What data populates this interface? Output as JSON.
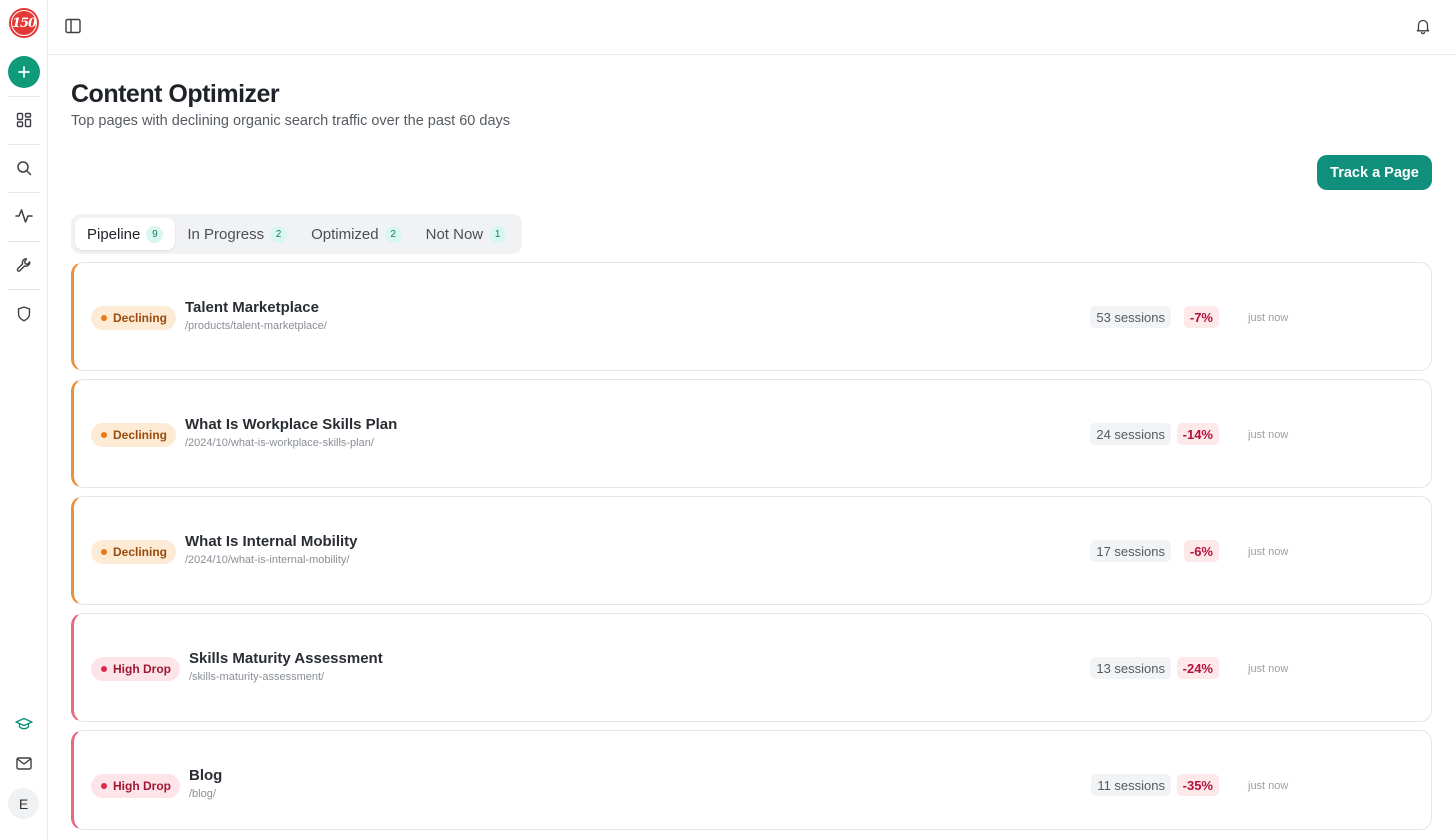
{
  "sidebar": {
    "logo_text": "150",
    "avatar_initial": "E",
    "icons": [
      "plus-icon",
      "dashboard-icon",
      "search-icon",
      "activity-icon",
      "wrench-icon",
      "shield-icon",
      "graduation-cap-icon",
      "mail-icon"
    ]
  },
  "header": {
    "title": "Content Optimizer",
    "subtitle": "Top pages with declining organic search traffic over the past 60 days",
    "track_button": "Track a Page"
  },
  "tabs": [
    {
      "label": "Pipeline",
      "count": "9",
      "active": true
    },
    {
      "label": "In Progress",
      "count": "2",
      "active": false
    },
    {
      "label": "Optimized",
      "count": "2",
      "active": false
    },
    {
      "label": "Not Now",
      "count": "1",
      "active": false
    }
  ],
  "pages": [
    {
      "status": "Declining",
      "title": "Talent Marketplace",
      "path": "/products/talent-marketplace/",
      "sessions": "53 sessions",
      "change": "-7%",
      "updated": "just now"
    },
    {
      "status": "Declining",
      "title": "What Is Workplace Skills Plan",
      "path": "/2024/10/what-is-workplace-skills-plan/",
      "sessions": "24 sessions",
      "change": "-14%",
      "updated": "just now"
    },
    {
      "status": "Declining",
      "title": "What Is Internal Mobility",
      "path": "/2024/10/what-is-internal-mobility/",
      "sessions": "17 sessions",
      "change": "-6%",
      "updated": "just now"
    },
    {
      "status": "High Drop",
      "title": "Skills Maturity Assessment",
      "path": "/skills-maturity-assessment/",
      "sessions": "13 sessions",
      "change": "-24%",
      "updated": "just now"
    },
    {
      "status": "High Drop",
      "title": "Blog",
      "path": "/blog/",
      "sessions": "11 sessions",
      "change": "-35%",
      "updated": "just now"
    }
  ],
  "colors": {
    "accent": "#0f8f7c",
    "declining": "#e8923c",
    "high_drop": "#e46b80"
  }
}
